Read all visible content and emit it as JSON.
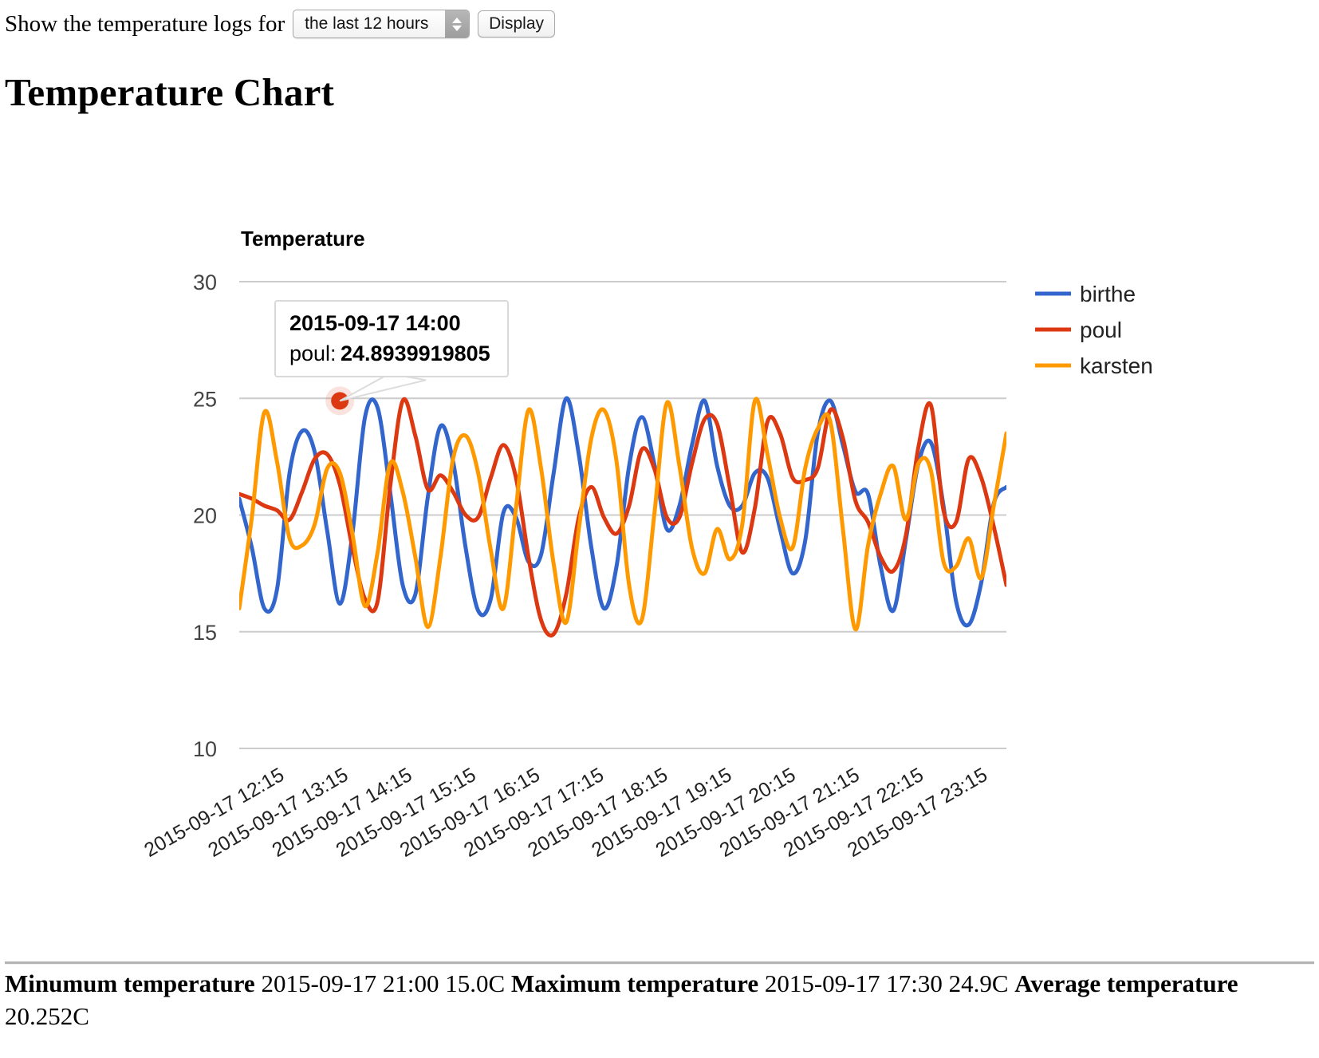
{
  "toolbar": {
    "prompt_label": "Show the temperature logs for",
    "range_select": {
      "value": "the last 12 hours",
      "options": [
        "the last 12 hours"
      ]
    },
    "display_button": "Display"
  },
  "page_title": "Temperature Chart",
  "tooltip": {
    "timestamp": "2015-09-17 14:00",
    "series_label": "poul:",
    "value": "24.8939919805"
  },
  "footer": {
    "min_label": "Minumum temperature",
    "min_value": "2015-09-17 21:00 15.0C",
    "max_label": "Maximum temperature",
    "max_value": "2015-09-17 17:30 24.9C",
    "avg_label": "Average temperature",
    "avg_value": "20.252C"
  },
  "colors": {
    "birthe": "#3366cc",
    "poul": "#dc3912",
    "karsten": "#ff9900",
    "gridline": "#cccccc",
    "axis_text": "#444444"
  },
  "chart_data": {
    "type": "line",
    "title": "Temperature",
    "xlabel": "",
    "ylabel": "",
    "ylim": [
      10,
      30
    ],
    "yticks": [
      30,
      25,
      20,
      15,
      10
    ],
    "grid": true,
    "legend_position": "right",
    "curve_type": "function",
    "xticks": [
      "2015-09-17 12:15",
      "2015-09-17 13:15",
      "2015-09-17 14:15",
      "2015-09-17 15:15",
      "2015-09-17 16:15",
      "2015-09-17 17:15",
      "2015-09-17 18:15",
      "2015-09-17 19:15",
      "2015-09-17 20:15",
      "2015-09-17 21:15",
      "2015-09-17 22:15",
      "2015-09-17 23:15"
    ],
    "highlight_point": {
      "series": "poul",
      "x_index": 8,
      "value": 24.894
    },
    "series": [
      {
        "name": "birthe",
        "color": "#3366cc",
        "values": [
          20.7,
          18.6,
          16.0,
          16.8,
          21.8,
          23.6,
          22.7,
          19.3,
          16.2,
          19.2,
          24.2,
          24.6,
          21.0,
          17.0,
          16.6,
          20.8,
          23.8,
          22.3,
          18.6,
          15.9,
          16.4,
          20.1,
          19.9,
          18.0,
          18.3,
          21.8,
          25.0,
          22.6,
          18.6,
          16.0,
          17.8,
          22.1,
          24.2,
          22.2,
          19.4,
          20.4,
          23.0,
          24.9,
          22.1,
          20.4,
          20.4,
          21.8,
          21.6,
          19.4,
          17.5,
          18.9,
          23.5,
          24.9,
          23.0,
          21.0,
          20.9,
          17.8,
          15.9,
          18.9,
          22.2,
          23.1,
          20.4,
          16.3,
          15.3,
          17.1,
          20.5,
          21.2
        ]
      },
      {
        "name": "poul",
        "color": "#dc3912",
        "values": [
          20.9,
          20.7,
          20.4,
          20.2,
          19.8,
          21.0,
          22.4,
          22.6,
          21.3,
          18.6,
          16.4,
          16.3,
          21.2,
          24.9,
          23.4,
          21.1,
          21.7,
          21.0,
          20.0,
          19.9,
          21.6,
          23.0,
          21.6,
          18.2,
          15.5,
          14.9,
          16.6,
          19.9,
          21.2,
          19.9,
          19.2,
          20.4,
          22.8,
          22.0,
          19.9,
          19.9,
          22.2,
          24.1,
          23.9,
          21.2,
          18.4,
          20.3,
          24.0,
          23.5,
          21.6,
          21.5,
          22.0,
          24.5,
          23.3,
          20.6,
          19.7,
          18.2,
          17.6,
          19.1,
          22.9,
          24.7,
          20.2,
          19.7,
          22.4,
          21.6,
          19.5,
          17.0
        ]
      },
      {
        "name": "karsten",
        "color": "#ff9900",
        "values": [
          16.0,
          19.9,
          24.4,
          22.3,
          19.0,
          18.7,
          19.6,
          22.0,
          21.8,
          19.2,
          16.1,
          18.4,
          22.2,
          21.0,
          18.2,
          15.2,
          18.2,
          22.4,
          23.4,
          21.8,
          18.5,
          16.0,
          20.3,
          24.5,
          22.0,
          17.9,
          15.4,
          19.4,
          23.3,
          24.5,
          22.3,
          17.0,
          15.5,
          20.0,
          24.8,
          22.1,
          18.6,
          17.5,
          19.4,
          18.1,
          19.6,
          24.9,
          22.6,
          19.9,
          18.6,
          22.0,
          23.7,
          24.0,
          19.4,
          15.1,
          18.7,
          20.9,
          22.1,
          19.8,
          22.2,
          21.9,
          18.0,
          17.8,
          19.0,
          17.3,
          20.4,
          23.5
        ]
      }
    ]
  }
}
